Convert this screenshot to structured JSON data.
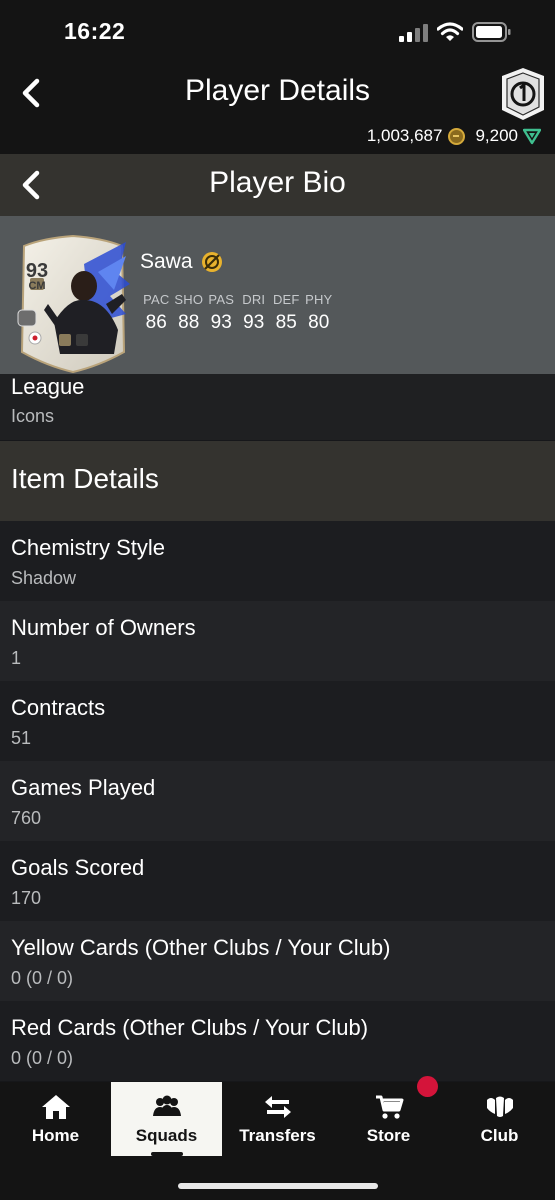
{
  "status_bar": {
    "time": "16:22"
  },
  "header": {
    "title": "Player Details",
    "coins": "1,003,687",
    "points": "9,200"
  },
  "subheader": {
    "title": "Player Bio"
  },
  "player": {
    "name": "Sawa",
    "card": {
      "rating": "93",
      "position": "CM"
    },
    "stats": [
      {
        "label": "PAC",
        "value": "86"
      },
      {
        "label": "SHO",
        "value": "88"
      },
      {
        "label": "PAS",
        "value": "93"
      },
      {
        "label": "DRI",
        "value": "93"
      },
      {
        "label": "DEF",
        "value": "85"
      },
      {
        "label": "PHY",
        "value": "80"
      }
    ]
  },
  "league": {
    "label": "League",
    "value": "Icons"
  },
  "item_details": {
    "title": "Item Details",
    "rows": [
      {
        "label": "Chemistry Style",
        "value": "Shadow"
      },
      {
        "label": "Number of Owners",
        "value": "1"
      },
      {
        "label": "Contracts",
        "value": "51"
      },
      {
        "label": "Games Played",
        "value": "760"
      },
      {
        "label": "Goals Scored",
        "value": "170"
      },
      {
        "label": "Yellow Cards (Other Clubs / Your Club)",
        "value": "0 (0 / 0)"
      },
      {
        "label": "Red Cards (Other Clubs / Your Club)",
        "value": "0 (0 / 0)"
      }
    ]
  },
  "nav": {
    "items": [
      {
        "label": "Home",
        "icon": "home-icon"
      },
      {
        "label": "Squads",
        "icon": "squads-icon"
      },
      {
        "label": "Transfers",
        "icon": "transfers-icon"
      },
      {
        "label": "Store",
        "icon": "store-icon"
      },
      {
        "label": "Club",
        "icon": "club-icon"
      }
    ],
    "active": "Squads"
  },
  "colors": {
    "accent_gold": "#e8b22e",
    "active_tab_bg": "#f6f6f2",
    "notification": "#d4143a",
    "panel_bg": "#54585a"
  }
}
